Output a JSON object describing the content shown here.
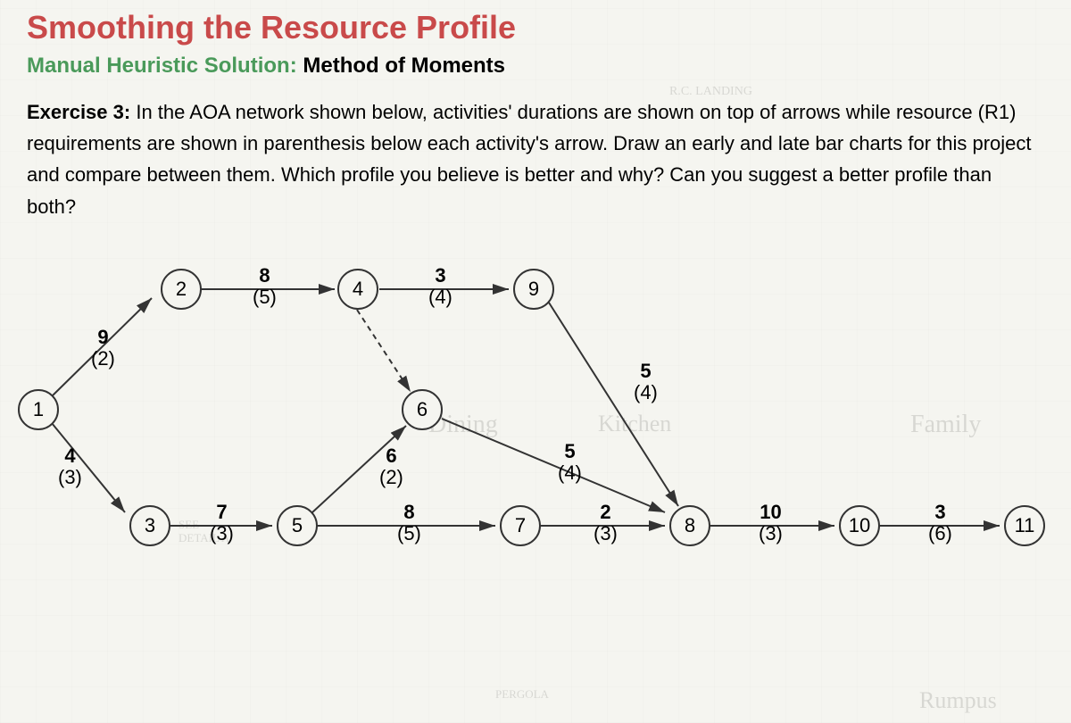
{
  "title": "Smoothing the Resource Profile",
  "subtitle": {
    "green": "Manual Heuristic Solution:",
    "black": "Method of Moments"
  },
  "exercise": {
    "label": "Exercise 3:",
    "text": "In the AOA network shown below, activities' durations are shown on top of arrows while resource (R1) requirements are shown in parenthesis below each activity's arrow. Draw an early and late bar charts for this project and compare between them. Which profile you believe is better and why? Can you suggest a better profile than both?"
  },
  "bg_words": {
    "dining": "Dining",
    "family": "Family",
    "rumpus": "Rumpus",
    "landing": "R.C. LANDING",
    "detail": "DETAIL A",
    "see": "SEE",
    "kitchen": "Kitchen",
    "pergola": "PERGOLA"
  },
  "nodes": {
    "n1": "1",
    "n2": "2",
    "n3": "3",
    "n4": "4",
    "n5": "5",
    "n6": "6",
    "n7": "7",
    "n8": "8",
    "n9": "9",
    "n10": "10",
    "n11": "11"
  },
  "edges": {
    "e1_2": {
      "dur": "9",
      "res": "(2)"
    },
    "e1_3": {
      "dur": "4",
      "res": "(3)"
    },
    "e2_4": {
      "dur": "8",
      "res": "(5)"
    },
    "e4_9": {
      "dur": "3",
      "res": "(4)"
    },
    "e3_5": {
      "dur": "7",
      "res": "(3)"
    },
    "e5_6": {
      "dur": "6",
      "res": "(2)"
    },
    "e5_7": {
      "dur": "8",
      "res": "(5)"
    },
    "e6_8": {
      "dur": "5",
      "res": "(4)"
    },
    "e7_8": {
      "dur": "2",
      "res": "(3)"
    },
    "e9_8": {
      "dur": "5",
      "res": "(4)"
    },
    "e8_10": {
      "dur": "10",
      "res": "(3)"
    },
    "e10_11": {
      "dur": "3",
      "res": "(6)"
    }
  }
}
